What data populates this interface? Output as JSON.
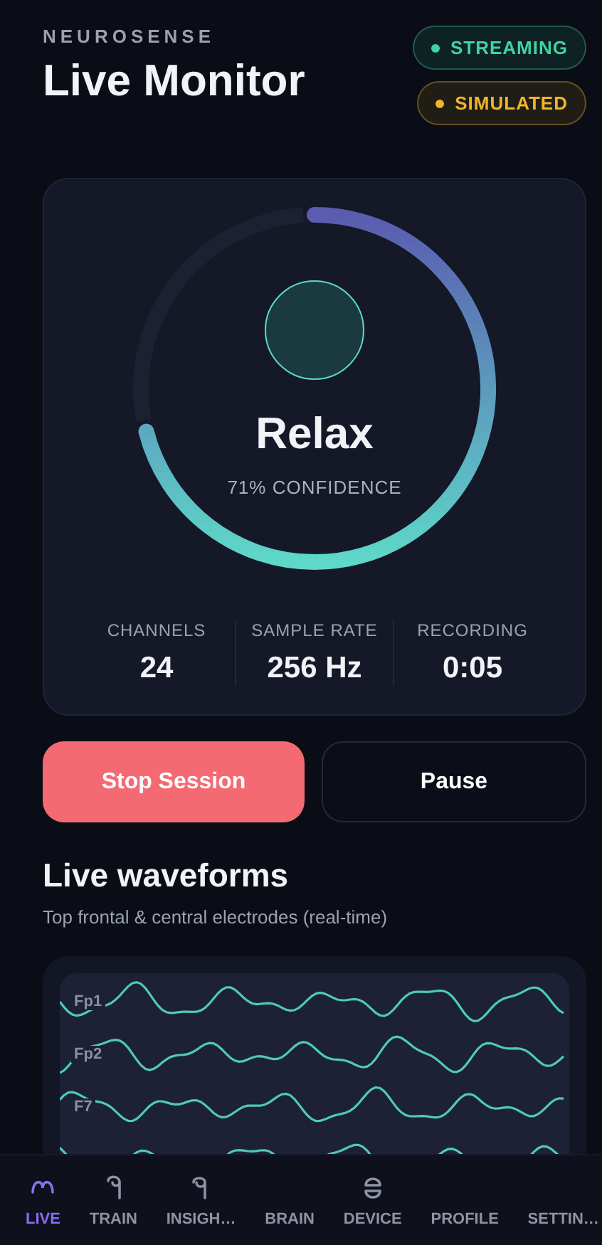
{
  "header": {
    "brand": "NEUROSENSE",
    "title": "Live Monitor",
    "badges": [
      {
        "label": "STREAMING",
        "color": "#3fd3a0"
      },
      {
        "label": "SIMULATED",
        "color": "#f0b429"
      }
    ]
  },
  "state_card": {
    "state": "Relax",
    "confidence": "71% CONFIDENCE",
    "stats": [
      {
        "label": "CHANNELS",
        "value": "24"
      },
      {
        "label": "SAMPLE RATE",
        "value": "256 Hz"
      },
      {
        "label": "RECORDING",
        "value": "0:05"
      }
    ]
  },
  "buttons": [
    {
      "label": "Stop Session",
      "kind": "primary"
    },
    {
      "label": "Pause",
      "kind": "secondary"
    }
  ],
  "waveforms": {
    "title": "Live waveforms",
    "subtitle": "Top frontal & central electrodes (real-time)",
    "channels": [
      "Fp1",
      "Fp2",
      "F7"
    ]
  },
  "nav": [
    {
      "label": "LIVE",
      "selected": true,
      "kind": "icon"
    },
    {
      "label": "TRAIN",
      "selected": false,
      "kind": "icon"
    },
    {
      "label": "INSIGH…",
      "selected": false,
      "kind": "icon"
    },
    {
      "label": "BRAIN",
      "selected": false,
      "kind": "plain"
    },
    {
      "label": "DEVICE",
      "selected": false,
      "kind": "icon"
    },
    {
      "label": "PROFILE",
      "selected": false,
      "kind": "plain"
    },
    {
      "label": "SETTIN…",
      "selected": false,
      "kind": "plain"
    }
  ]
}
